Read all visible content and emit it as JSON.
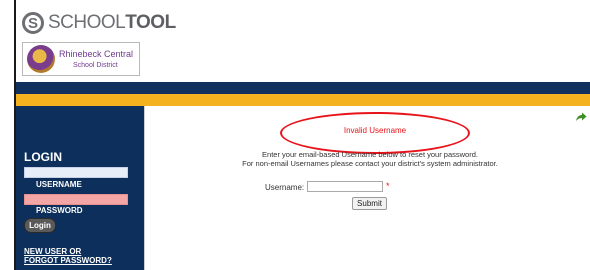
{
  "brand": {
    "logo_letter": "S",
    "logo_prefix": "SCHOOL",
    "logo_suffix": "TOOL",
    "district_name": "Rhinebeck Central",
    "district_sub": "School District"
  },
  "sidebar": {
    "heading": "LOGIN",
    "username_label": "USERNAME",
    "username_value": "",
    "password_label": "PASSWORD",
    "password_value": "",
    "login_button": "Login",
    "forgot_line1": "NEW USER OR",
    "forgot_line2": "FORGOT PASSWORD?"
  },
  "main": {
    "error_message": "Invalid Username",
    "instruction_line1": "Enter your email-based Username below to reset your password.",
    "instruction_line2": "For non-email Usernames please contact your district's system administrator.",
    "username_label": "Username:",
    "username_value": "",
    "required_marker": "*",
    "submit_label": "Submit"
  },
  "icons": {
    "back": "return-arrow-icon"
  },
  "colors": {
    "navy": "#10305e",
    "gold": "#f4b21e",
    "error": "#e8141b",
    "arrow": "#3e8e27"
  }
}
